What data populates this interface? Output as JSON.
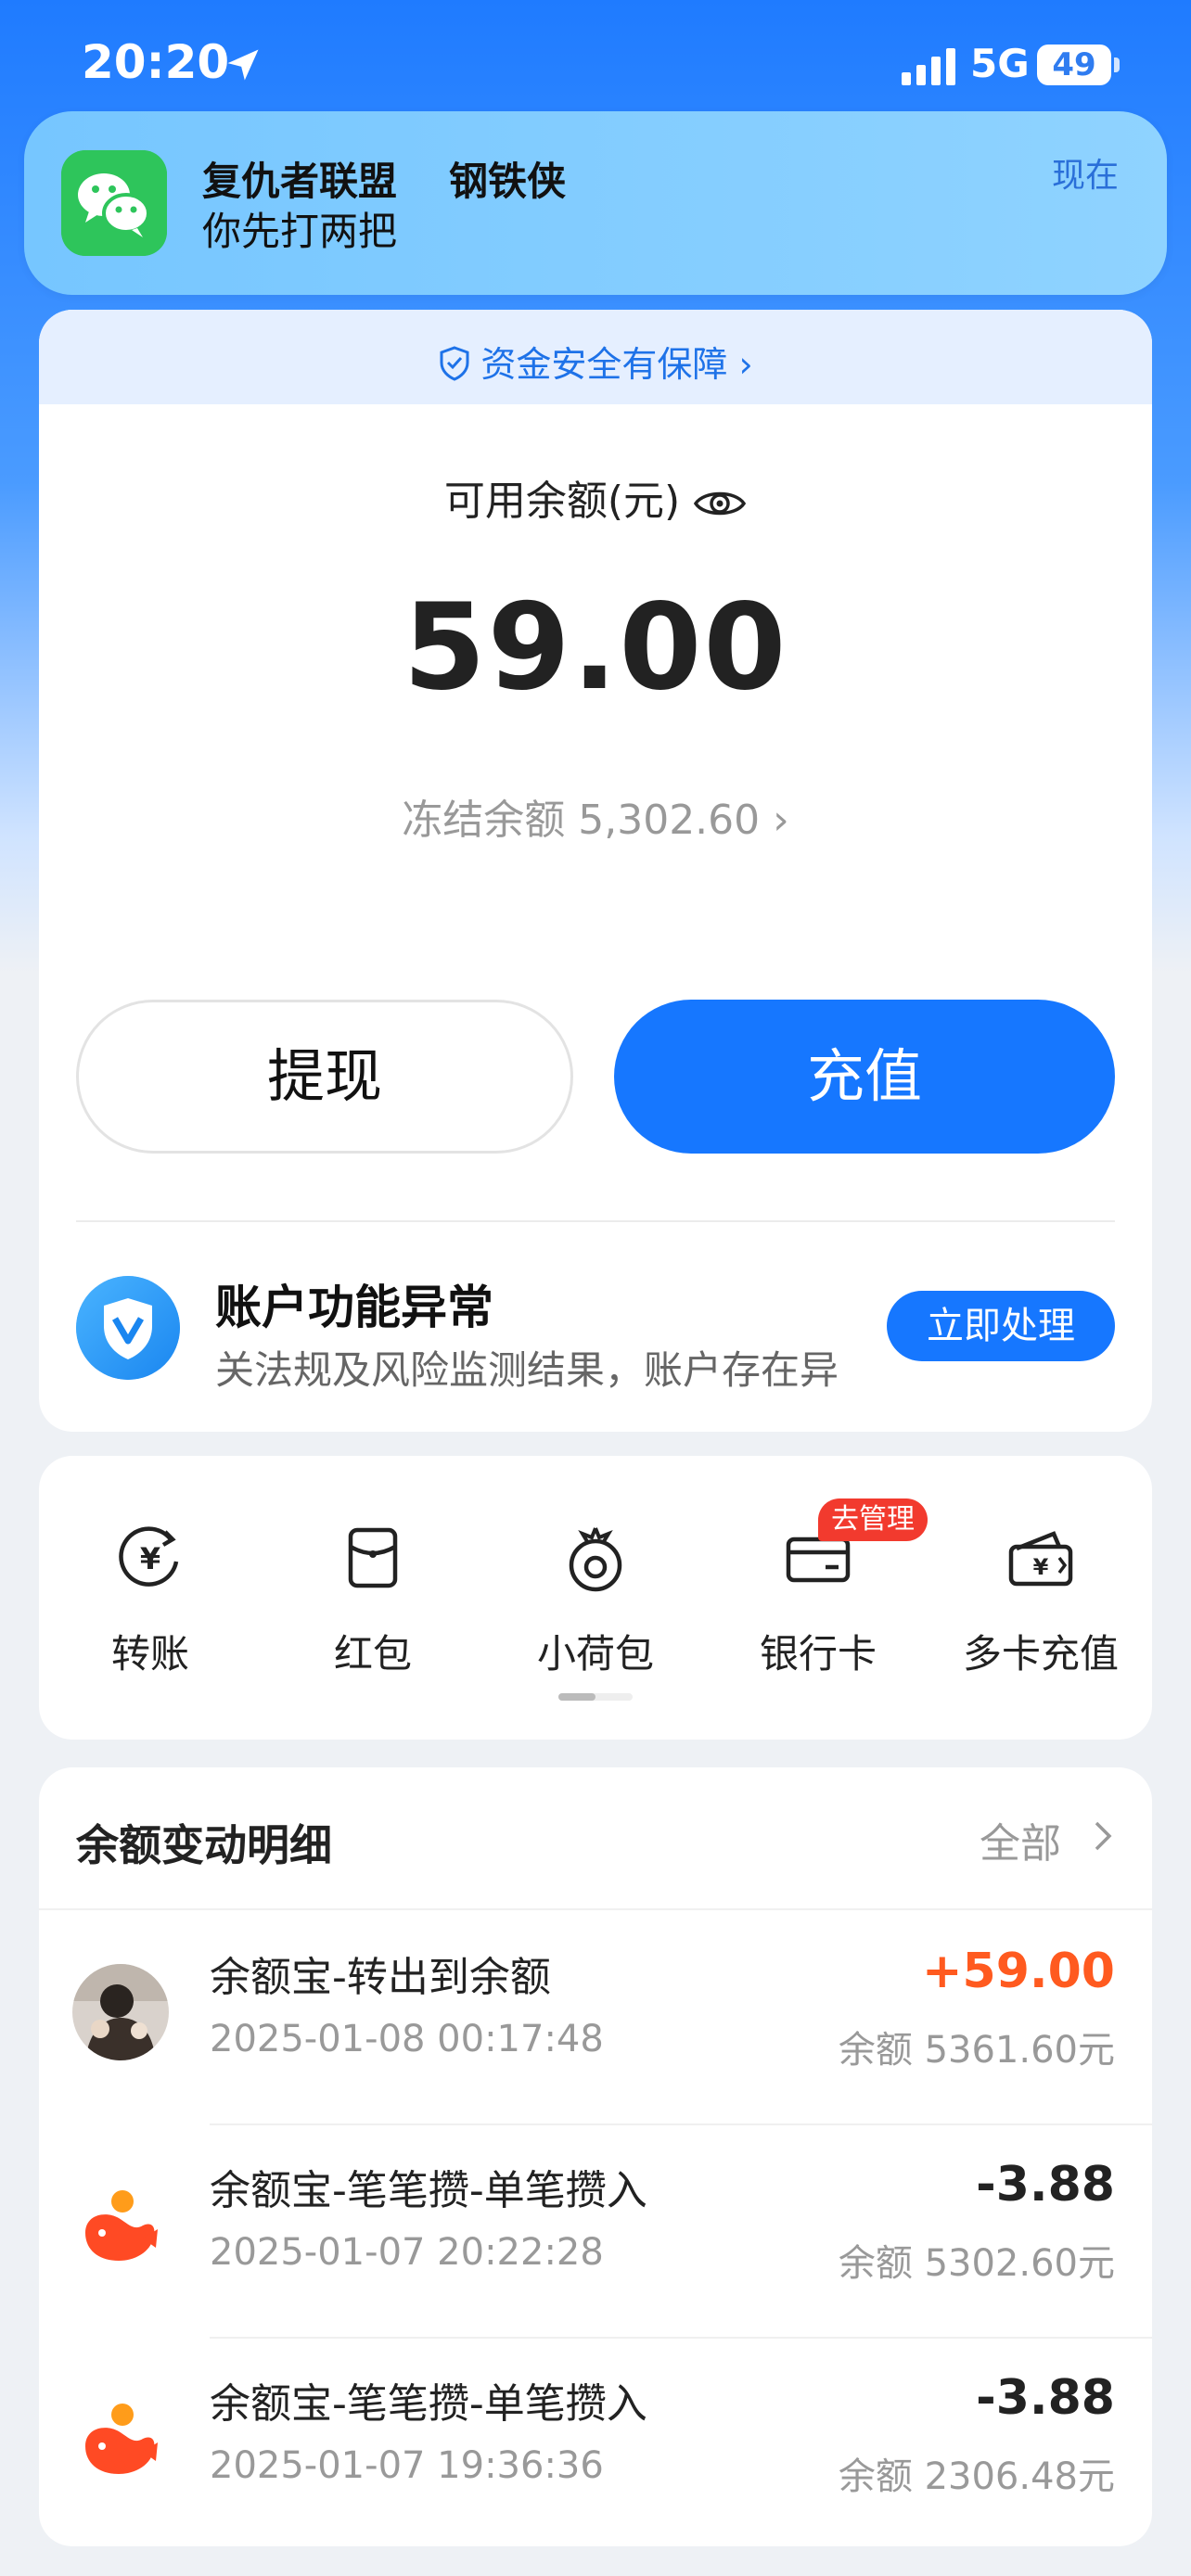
{
  "status_bar": {
    "time": "20:20",
    "network": "5G",
    "battery": "49"
  },
  "notification": {
    "title": "复仇者联盟",
    "title2": "钢铁侠",
    "message": "你先打两把",
    "time": "现在"
  },
  "balance_card": {
    "safety_text": "资金安全有保障",
    "label": "可用余额(元)",
    "amount": "59.00",
    "frozen_label": "冻结余额",
    "frozen_amount": "5,302.60",
    "withdraw_label": "提现",
    "topup_label": "充值"
  },
  "alert": {
    "title": "账户功能异常",
    "desc": "关法规及风险监测结果，账户存在异",
    "button": "立即处理"
  },
  "quick_actions": {
    "items": [
      {
        "label": "转账",
        "icon": "transfer-icon"
      },
      {
        "label": "红包",
        "icon": "red-envelope-icon"
      },
      {
        "label": "小荷包",
        "icon": "small-pouch-icon"
      },
      {
        "label": "银行卡",
        "icon": "bank-card-icon"
      },
      {
        "label": "多卡充值",
        "icon": "multi-card-topup-icon"
      }
    ],
    "badge": "去管理"
  },
  "transactions": {
    "title": "余额变动明细",
    "all_label": "全部",
    "rows": [
      {
        "name": "余额宝-转出到余额",
        "date": "2025-01-08 00:17:48",
        "amount": "+59.00",
        "balance": "余额 5361.60元",
        "amount_color": "#ff5a1f"
      },
      {
        "name": "余额宝-笔笔攒-单笔攒入",
        "date": "2025-01-07 20:22:28",
        "amount": "-3.88",
        "balance": "余额 5302.60元",
        "amount_color": "#222222"
      },
      {
        "name": "余额宝-笔笔攒-单笔攒入",
        "date": "2025-01-07 19:36:36",
        "amount": "-3.88",
        "balance": "余额 2306.48元",
        "amount_color": "#222222"
      }
    ]
  },
  "colors": {
    "accent": "#1677ff",
    "positive": "#ff5a1f",
    "badge": "#f23a2e"
  }
}
